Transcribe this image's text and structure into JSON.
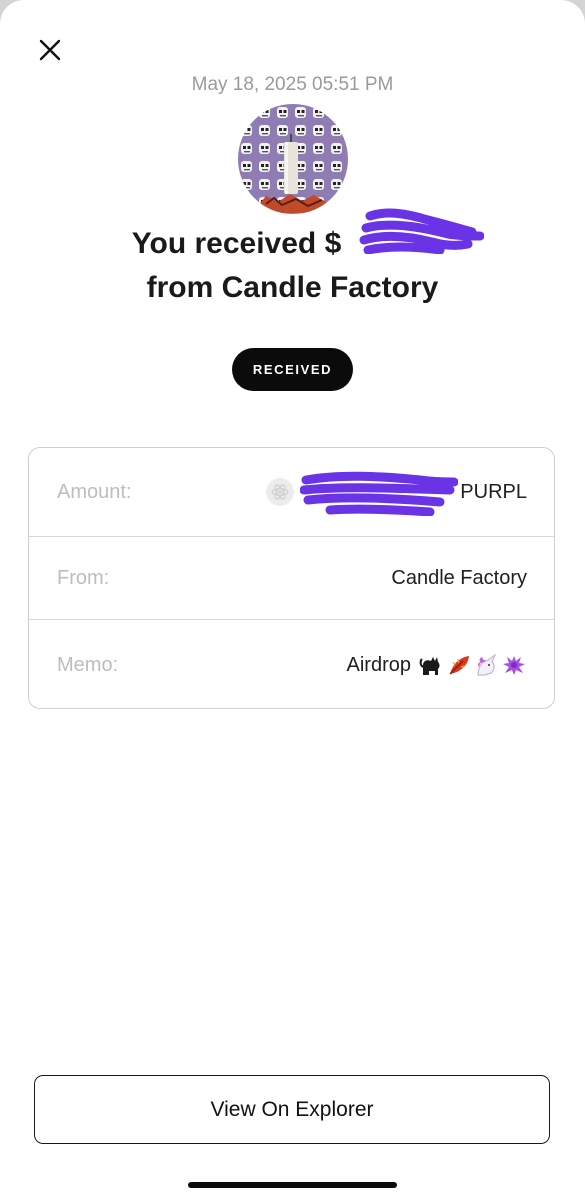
{
  "header": {
    "close_icon": "close-icon",
    "timestamp": "May 18, 2025 05:51 PM"
  },
  "avatar": {
    "description_icon": "candle-skull-avatar",
    "background_color": "#8f7cb2"
  },
  "headline": {
    "line1_prefix": "You received $",
    "line2": "from Candle Factory"
  },
  "status_badge": {
    "label": "RECEIVED"
  },
  "details": {
    "amount": {
      "label": "Amount:",
      "token_icon": "atom-icon",
      "currency": "PURPL"
    },
    "from": {
      "label": "From:",
      "value": "Candle Factory"
    },
    "memo": {
      "label": "Memo:",
      "text": "Airdrop",
      "emojis": [
        "black-cat-icon",
        "leaf-icon",
        "unicorn-icon",
        "purple-splat-icon"
      ]
    }
  },
  "footer": {
    "explorer_button_label": "View On Explorer"
  },
  "colors": {
    "redaction": "#6a34e6",
    "badge_bg": "#0b0b0b",
    "label_gray": "#bdbdbd",
    "timestamp_gray": "#9a9a9a"
  }
}
